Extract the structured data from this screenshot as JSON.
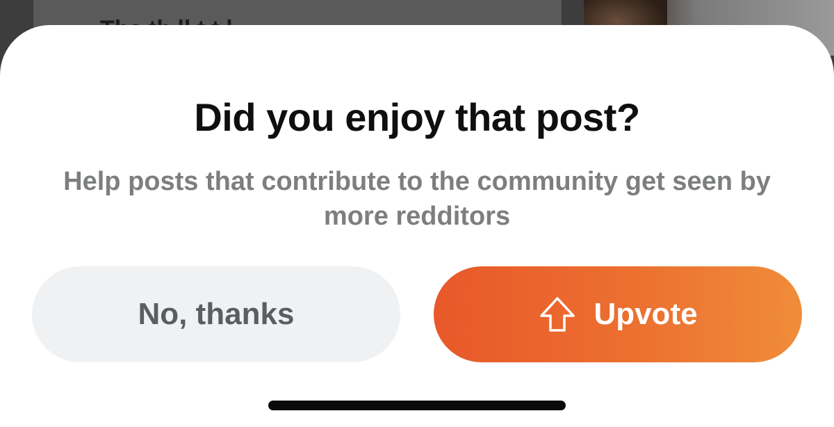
{
  "background": {
    "post_text_fragment": "The th   ll        t t         l   "
  },
  "sheet": {
    "title": "Did you enjoy that post?",
    "subtitle": "Help posts that contribute to the community get seen by more redditors",
    "no_button_label": "No, thanks",
    "upvote_button_label": "Upvote",
    "upvote_icon": "arrow-up-icon"
  },
  "colors": {
    "upvote_gradient_start": "#e8582a",
    "upvote_gradient_end": "#ef8d3a",
    "no_button_bg": "#f0f1f3",
    "title": "#0f0f0f",
    "subtitle": "#7c7e80"
  }
}
